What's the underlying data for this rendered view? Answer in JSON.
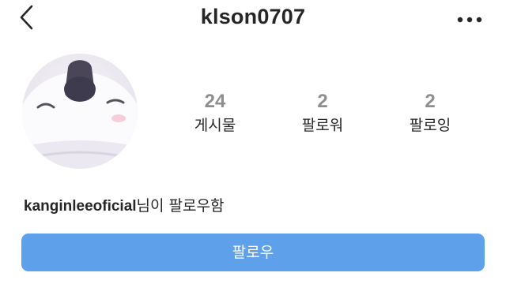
{
  "header": {
    "username": "klson0707",
    "back_icon": "chevron-left-icon",
    "more_icon": "more-horizontal-icon"
  },
  "profile": {
    "avatar": "penguin-character-avatar"
  },
  "stats": {
    "posts": {
      "value": "24",
      "label": "게시물"
    },
    "followers": {
      "value": "2",
      "label": "팔로워"
    },
    "following": {
      "value": "2",
      "label": "팔로잉"
    }
  },
  "followed_by": {
    "username": "kanginleeoficial",
    "suffix": "님이 팔로우함"
  },
  "actions": {
    "follow_label": "팔로우",
    "follow_color": "#5ea0ea"
  }
}
